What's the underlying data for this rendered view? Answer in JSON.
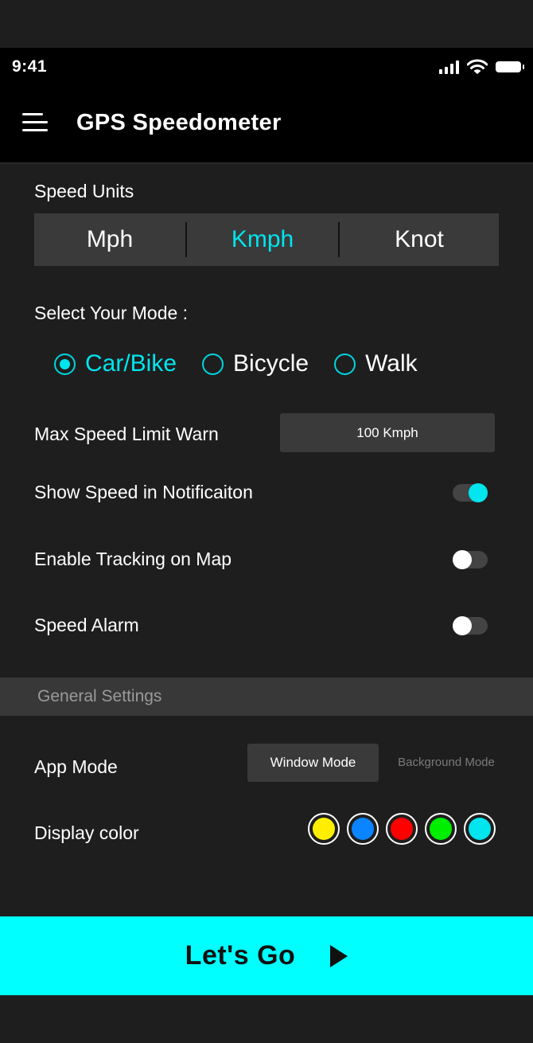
{
  "status_bar": {
    "time": "9:41",
    "icons": [
      "signal-icon",
      "wifi-icon",
      "battery-icon"
    ]
  },
  "app_bar": {
    "title": "GPS Speedometer",
    "menu_icon": "hamburger-menu-icon"
  },
  "speed_units": {
    "label": "Speed Units",
    "options": [
      "Mph",
      "Kmph",
      "Knot"
    ],
    "selected": "Kmph"
  },
  "mode": {
    "label": "Select Your Mode :",
    "options": [
      "Car/Bike",
      "Bicycle",
      "Walk"
    ],
    "selected": "Car/Bike"
  },
  "max_speed": {
    "label": "Max Speed Limit Warn",
    "value": "100 Kmph"
  },
  "toggles": [
    {
      "label": "Show Speed in Notificaiton",
      "on": true
    },
    {
      "label": "Enable Tracking on Map",
      "on": false
    },
    {
      "label": "Speed Alarm",
      "on": false
    }
  ],
  "general": {
    "header": "General Settings",
    "app_mode": {
      "label": "App Mode",
      "options": [
        "Window Mode",
        "Background Mode"
      ],
      "selected": "Window Mode"
    },
    "display_color": {
      "label": "Display color",
      "colors": [
        "#ffee00",
        "#0a84ff",
        "#ff0000",
        "#00ee00",
        "#00e5ee"
      ]
    }
  },
  "cta": {
    "label": "Let's Go",
    "icon": "play-icon"
  },
  "accent_color": "#00e5ee"
}
